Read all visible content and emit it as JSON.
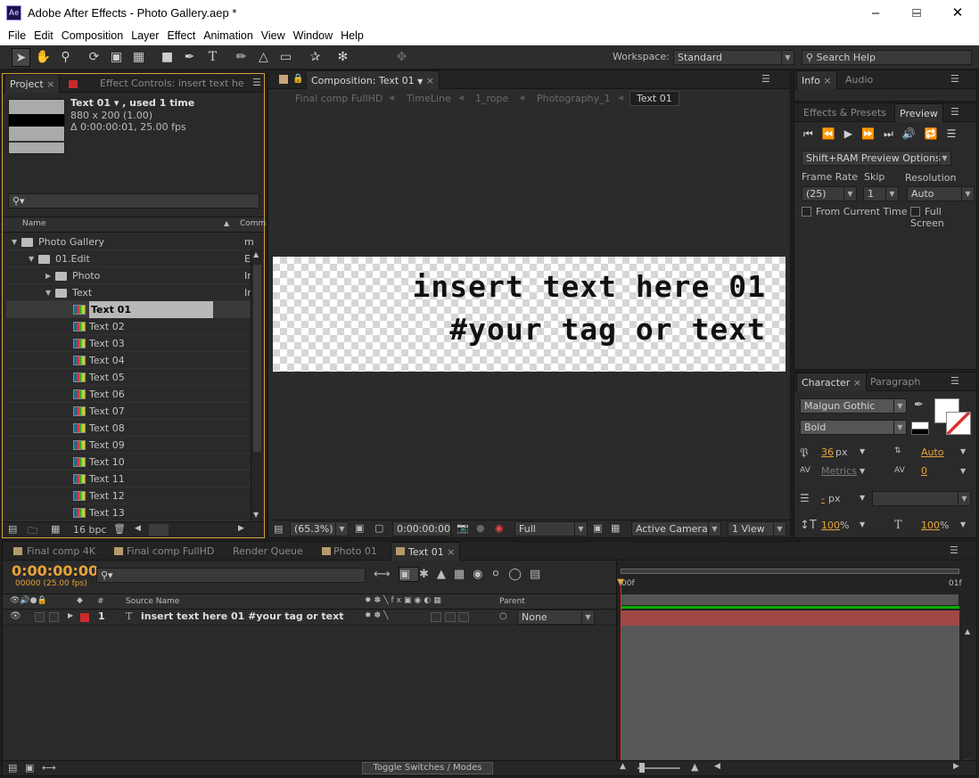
{
  "app": {
    "title": "Adobe After Effects - Photo Gallery.aep *",
    "logo": "Ae"
  },
  "menu": [
    "File",
    "Edit",
    "Composition",
    "Layer",
    "Effect",
    "Animation",
    "View",
    "Window",
    "Help"
  ],
  "toolbar": {
    "workspace_label": "Workspace:",
    "workspace_value": "Standard",
    "search_placeholder": "Search Help"
  },
  "project": {
    "tabs": [
      "Project",
      "Effect Controls: insert text he"
    ],
    "selected_name": "Text 01 ▾ , used 1 time",
    "selected_size": "880 x 200 (1.00)",
    "selected_duration": "Δ 0:00:00:01, 25.00 fps",
    "col_name": "Name",
    "col_comment": "Comm",
    "rows": [
      {
        "label": "Photo Gallery",
        "comment": "m"
      },
      {
        "label": "01.Edit",
        "comment": "Ec"
      },
      {
        "label": "Photo",
        "comment": "Ir"
      },
      {
        "label": "Text",
        "comment": "Ir"
      },
      {
        "label": "Text 01"
      },
      {
        "label": "Text 02"
      },
      {
        "label": "Text 03"
      },
      {
        "label": "Text 04"
      },
      {
        "label": "Text 05"
      },
      {
        "label": "Text 06"
      },
      {
        "label": "Text 07"
      },
      {
        "label": "Text 08"
      },
      {
        "label": "Text 09"
      },
      {
        "label": "Text 10"
      },
      {
        "label": "Text 11"
      },
      {
        "label": "Text 12"
      },
      {
        "label": "Text 13"
      }
    ],
    "bpc": "16 bpc"
  },
  "composition": {
    "tab": "Composition: Text 01",
    "breadcrumbs": [
      "Final comp FullHD",
      "TimeLine",
      "1_rope",
      "Photography_1",
      "Text 01"
    ],
    "line1": "insert text here 01",
    "line2": "#your tag or text",
    "zoom": "(65.3%)",
    "timecode": "0:00:00:00",
    "resolution": "Full",
    "camera": "Active Camera",
    "views": "1 View"
  },
  "info": {
    "tabs": [
      "Info",
      "Audio"
    ]
  },
  "preview": {
    "tabs": [
      "Effects & Presets",
      "Preview"
    ],
    "options": "Shift+RAM Preview Options",
    "frame_rate_label": "Frame Rate",
    "skip_label": "Skip",
    "resolution_label": "Resolution",
    "frame_rate": "(25)",
    "skip": "1",
    "resolution": "Auto",
    "from_current": "From Current Time",
    "full_screen": "Full Screen"
  },
  "character": {
    "tabs": [
      "Character",
      "Paragraph"
    ],
    "font": "Malgun Gothic",
    "style": "Bold",
    "size": "36",
    "size_unit": "px",
    "leading": "Auto",
    "kerning": "Metrics",
    "tracking": "0",
    "stroke": "-",
    "stroke_unit": "px",
    "vscale": "100",
    "hscale": "100",
    "pct": "%"
  },
  "timeline": {
    "tabs": [
      "Final comp 4K",
      "Final comp FullHD",
      "Render Queue",
      "Photo 01",
      "Text 01"
    ],
    "timecode": "0:00:00:00",
    "frames": "00000 (25.00 fps)",
    "col_num": "#",
    "col_source": "Source Name",
    "col_parent": "Parent",
    "layer_num": "1",
    "layer_name": "insert text here 01 #your tag or text",
    "parent": "None",
    "ruler_start": "00f",
    "ruler_end": "01f",
    "toggle": "Toggle Switches / Modes"
  },
  "colors": {
    "accent_orange": "#e8a33a",
    "layer_bar": "#a04848",
    "label_red": "#cc2a2a"
  }
}
